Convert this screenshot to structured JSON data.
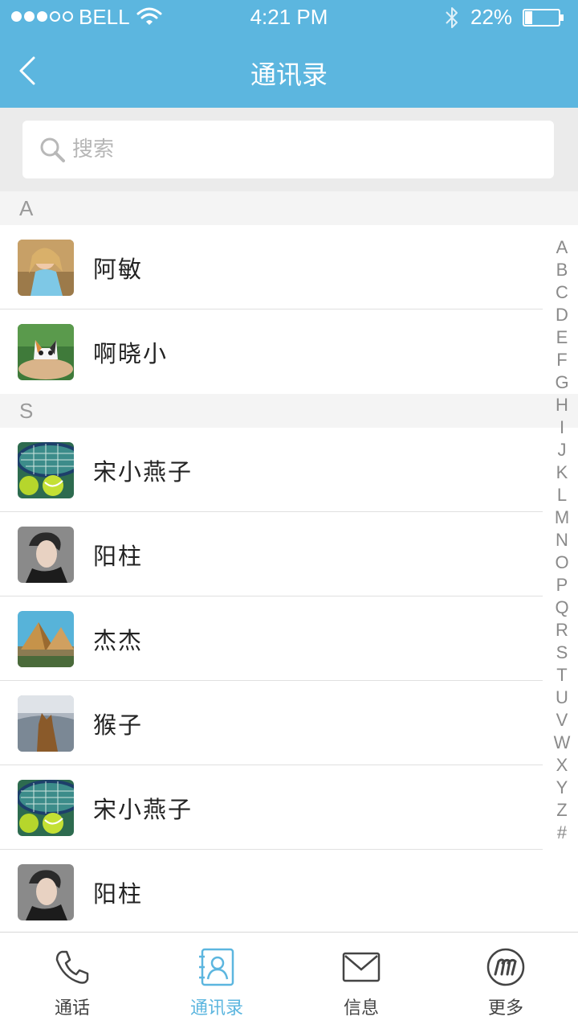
{
  "status_bar": {
    "carrier": "BELL",
    "time": "4:21 PM",
    "battery": "22%",
    "battery_level": 0.22,
    "signal_bars_filled": 3,
    "signal_bars_total": 5
  },
  "nav": {
    "title": "通讯录",
    "back_icon": "chevron-left-icon"
  },
  "search": {
    "placeholder": "搜索",
    "value": ""
  },
  "sections": [
    {
      "letter": "A",
      "contacts": [
        {
          "name": "阿敏",
          "avatar": "girl-photo"
        },
        {
          "name": "啊晓小",
          "avatar": "kitten-photo"
        }
      ]
    },
    {
      "letter": "S",
      "contacts": [
        {
          "name": "宋小燕子",
          "avatar": "tennis-photo"
        },
        {
          "name": "阳柱",
          "avatar": "portrait-photo"
        },
        {
          "name": "杰杰",
          "avatar": "pyramids-photo"
        },
        {
          "name": "猴子",
          "avatar": "cat-photo"
        },
        {
          "name": "宋小燕子",
          "avatar": "tennis-photo"
        },
        {
          "name": "阳柱",
          "avatar": "portrait-photo"
        }
      ]
    }
  ],
  "index_letters": [
    "A",
    "B",
    "C",
    "D",
    "E",
    "F",
    "G",
    "H",
    "I",
    "J",
    "K",
    "L",
    "M",
    "N",
    "O",
    "P",
    "Q",
    "R",
    "S",
    "T",
    "U",
    "V",
    "W",
    "X",
    "Y",
    "Z",
    "#"
  ],
  "tabs": [
    {
      "label": "通话",
      "icon": "phone-icon",
      "active": false
    },
    {
      "label": "通讯录",
      "icon": "contacts-icon",
      "active": true
    },
    {
      "label": "信息",
      "icon": "envelope-icon",
      "active": false
    },
    {
      "label": "更多",
      "icon": "more-m-icon",
      "active": false
    }
  ],
  "colors": {
    "accent": "#5cb6df",
    "section_bg": "#f4f4f4",
    "search_bg": "#ebebeb"
  }
}
